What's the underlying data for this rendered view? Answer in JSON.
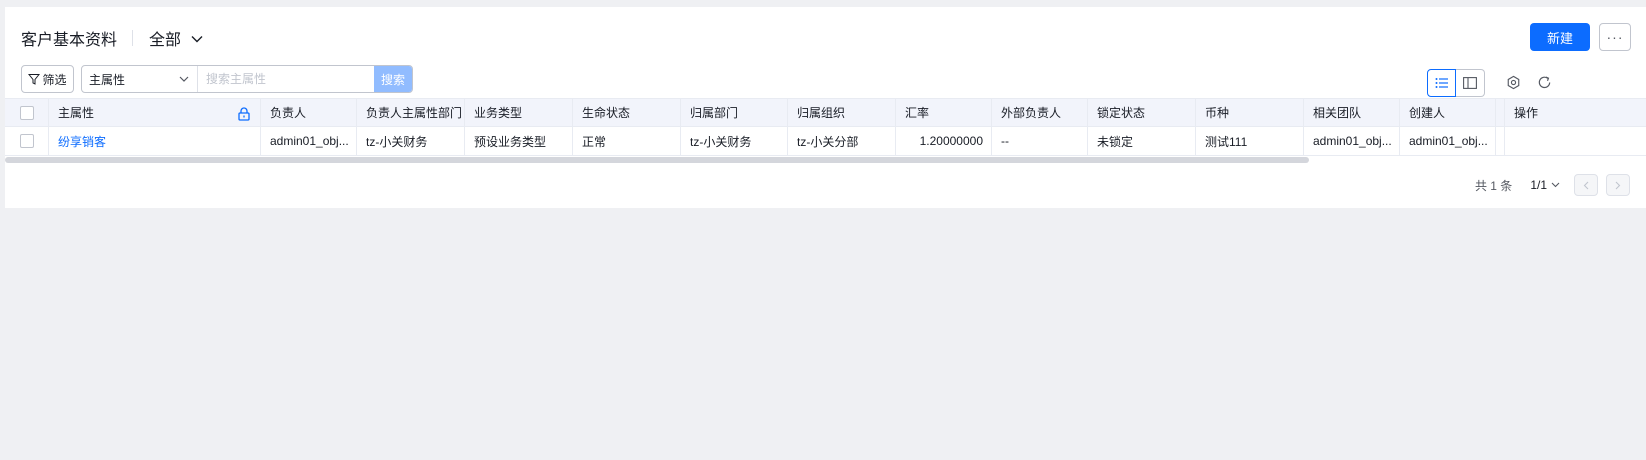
{
  "header": {
    "title": "客户基本资料",
    "view_label": "全部",
    "new_button": "新建",
    "more_button": "···"
  },
  "toolbar": {
    "filter_label": "筛选",
    "field_select": "主属性",
    "search_placeholder": "搜索主属性",
    "search_button": "搜索"
  },
  "table": {
    "columns": [
      "主属性",
      "负责人",
      "负责人主属性部门",
      "业务类型",
      "生命状态",
      "归属部门",
      "归属组织",
      "汇率",
      "外部负责人",
      "锁定状态",
      "币种",
      "相关团队",
      "创建人",
      "操作"
    ],
    "rows": [
      [
        "纷享销客",
        "admin01_obj...",
        "tz-小关财务",
        "预设业务类型",
        "正常",
        "tz-小关财务",
        "tz-小关分部",
        "1.20000000",
        "--",
        "未锁定",
        "测试111",
        "admin01_obj...",
        "admin01_obj...",
        ""
      ]
    ]
  },
  "pager": {
    "total": "共 1 条",
    "page": "1/1"
  },
  "colors": {
    "accent": "#0c6cff",
    "search_button": "#91bcff",
    "header_bg": "#f2f4fb",
    "page_bg": "#eff0f3"
  },
  "icons": [
    "chevron-down-icon",
    "filter-icon",
    "lock-icon",
    "list-view-icon",
    "split-view-icon",
    "settings-icon",
    "refresh-icon",
    "chevron-left-icon",
    "chevron-right-icon"
  ]
}
